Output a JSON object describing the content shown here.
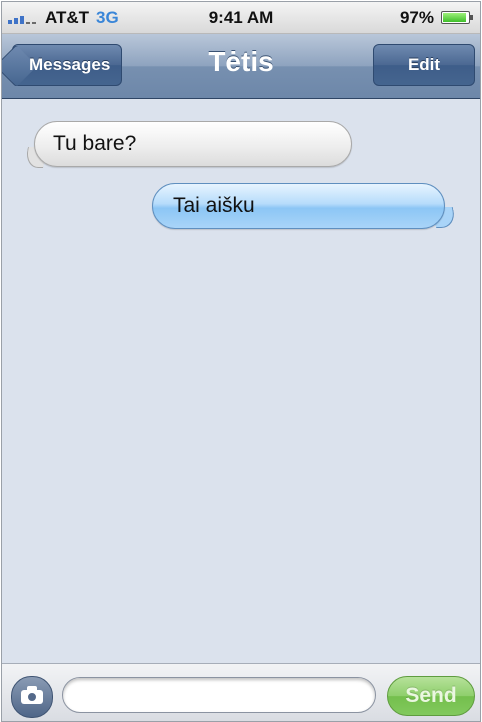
{
  "status_bar": {
    "carrier": "AT&T",
    "network": "3G",
    "time": "9:41 AM",
    "battery_percent": "97%",
    "battery_level": 0.97,
    "signal_bars": 3,
    "signal_max": 5,
    "colors": {
      "network": "#3a86d8",
      "battery": "#3fbf2a"
    }
  },
  "nav": {
    "back_label": "Messages",
    "title": "Tėtis",
    "edit_label": "Edit",
    "colors": {
      "bar": "#7790b0",
      "button": "#45658f"
    }
  },
  "messages": [
    {
      "direction": "incoming",
      "text": "Tu bare?"
    },
    {
      "direction": "outgoing",
      "text": "Tai aišku"
    }
  ],
  "input_bar": {
    "camera_icon": "camera-icon",
    "text_value": "",
    "send_label": "Send",
    "colors": {
      "send": "#82c95d"
    }
  }
}
